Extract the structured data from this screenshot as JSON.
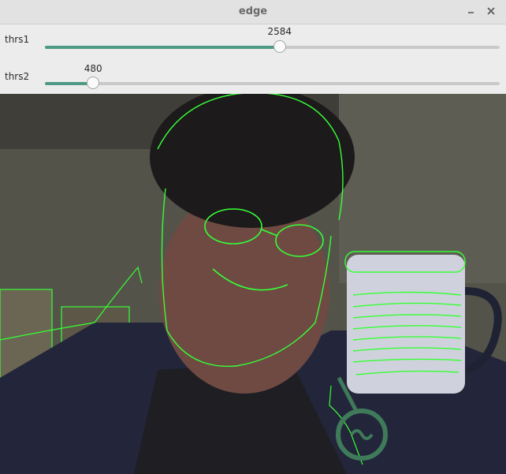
{
  "window": {
    "title": "edge"
  },
  "controls": {
    "minimize_icon": "minimize-icon",
    "close_icon": "close-icon"
  },
  "sliders": [
    {
      "label": "thrs1",
      "value": "2584",
      "fraction": 0.516
    },
    {
      "label": "thrs2",
      "value": "480",
      "fraction": 0.106
    }
  ],
  "colors": {
    "accent": "#4f9a84",
    "edge_overlay": "#36ff36"
  }
}
